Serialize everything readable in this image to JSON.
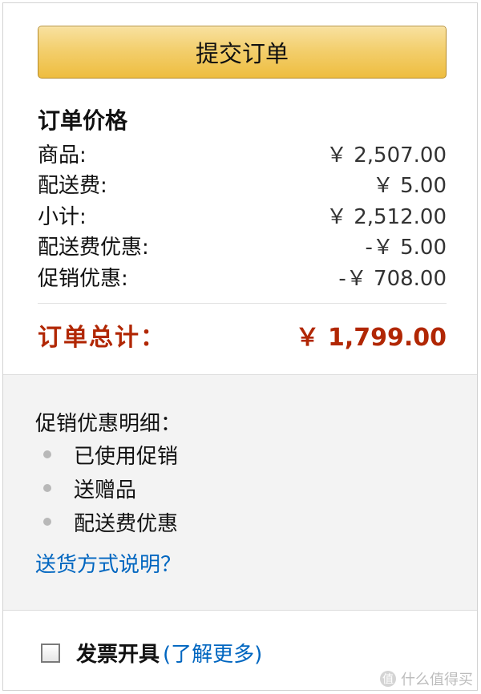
{
  "submit": {
    "label": "提交订单"
  },
  "price": {
    "title": "订单价格",
    "rows": [
      {
        "label": "商品:",
        "value": "￥ 2,507.00"
      },
      {
        "label": "配送费:",
        "value": "￥ 5.00"
      },
      {
        "label": "小计:",
        "value": "￥ 2,512.00"
      },
      {
        "label": "配送费优惠:",
        "value": "-￥ 5.00"
      },
      {
        "label": "促销优惠:",
        "value": "-￥ 708.00"
      }
    ],
    "total_label": "订单总计：",
    "total_value": "￥ 1,799.00"
  },
  "promo": {
    "title": "促销优惠明细：",
    "items": [
      "已使用促销",
      "送赠品",
      "配送费优惠"
    ],
    "shipping_link": "送货方式说明？"
  },
  "invoice": {
    "label": "发票开具",
    "link": "(了解更多)",
    "checked": false
  },
  "watermark": {
    "icon": "值",
    "text": "什么值得买"
  },
  "colors": {
    "total": "#b12704",
    "link": "#0066c0",
    "button": "#f0c14b"
  }
}
